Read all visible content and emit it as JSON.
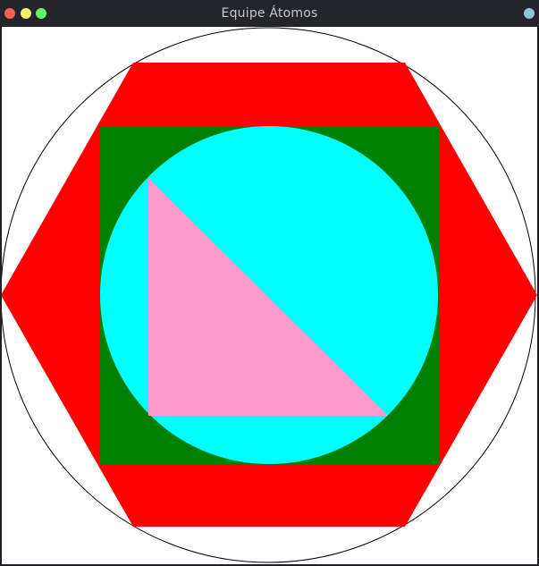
{
  "window": {
    "title": "Equipe Átomos",
    "controls": {
      "close_color": "#ff5f57",
      "minimize_color": "#f7f06a",
      "maximize_color": "#5ff567",
      "status_color": "#8fc2d8"
    }
  },
  "drawing": {
    "background_color": "#ffffff",
    "shapes": [
      {
        "name": "outer-circle",
        "type": "circle-outline",
        "stroke_color": "#000000"
      },
      {
        "name": "hexagon",
        "type": "hexagon",
        "fill_color": "#ff0000"
      },
      {
        "name": "square",
        "type": "square",
        "fill_color": "#008000"
      },
      {
        "name": "inner-circle",
        "type": "circle",
        "fill_color": "#00ffff"
      },
      {
        "name": "triangle",
        "type": "right-triangle",
        "fill_color": "#ff99cc"
      }
    ]
  }
}
